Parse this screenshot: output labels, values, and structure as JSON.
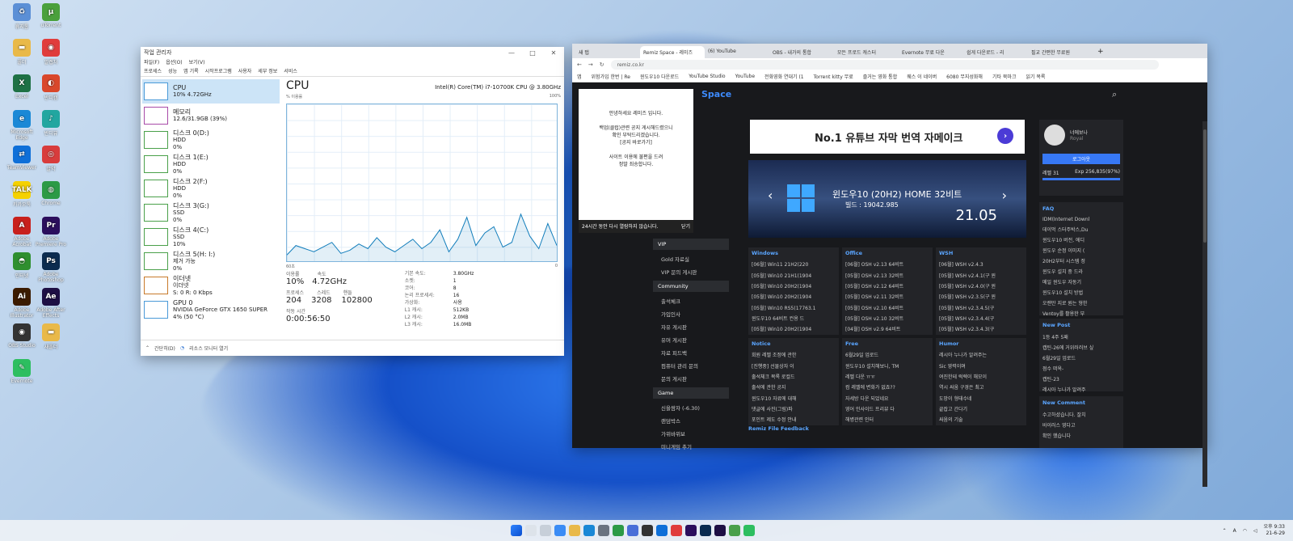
{
  "desktop": {
    "icons": [
      {
        "label": "휴지통",
        "color": "#5b8fd6",
        "glyph": "♻"
      },
      {
        "label": "uTorrent",
        "color": "#4aa03c",
        "glyph": "µ"
      },
      {
        "label": "폴더",
        "color": "#e9b949",
        "glyph": "▬"
      },
      {
        "label": "알캡처",
        "color": "#e03c3c",
        "glyph": "◉"
      },
      {
        "label": "Excel",
        "color": "#1e7145",
        "glyph": "X"
      },
      {
        "label": "반디캠",
        "color": "#d9472b",
        "glyph": "◐"
      },
      {
        "label": "Microsoft Edge",
        "color": "#1a88d6",
        "glyph": "e"
      },
      {
        "label": "반디뷰",
        "color": "#22a6a0",
        "glyph": "♪"
      },
      {
        "label": "TeamViewer",
        "color": "#0e6fd8",
        "glyph": "⇄"
      },
      {
        "label": "알약",
        "color": "#d83c3c",
        "glyph": "◎"
      },
      {
        "label": "카카오톡",
        "color": "#f5d100",
        "glyph": "TALK"
      },
      {
        "label": "Chrome",
        "color": "#2c9a46",
        "glyph": "◍"
      },
      {
        "label": "Adobe Acrobat",
        "color": "#c8201c",
        "glyph": "A"
      },
      {
        "label": "Adobe Premiere Pro",
        "color": "#2b0e5c",
        "glyph": "Pr"
      },
      {
        "label": "인터넷",
        "color": "#2f8f2f",
        "glyph": "◓"
      },
      {
        "label": "Adobe Photoshop",
        "color": "#0b2b4f",
        "glyph": "Ps"
      },
      {
        "label": "Adobe Illustrator",
        "color": "#3b1b00",
        "glyph": "Ai"
      },
      {
        "label": "Adobe After Effects",
        "color": "#1e0f44",
        "glyph": "Ae"
      },
      {
        "label": "OBS Studio",
        "color": "#333333",
        "glyph": "◉"
      },
      {
        "label": "새폴더",
        "color": "#e9b949",
        "glyph": "▬"
      },
      {
        "label": "Evernote",
        "color": "#2dbe60",
        "glyph": "✎"
      }
    ]
  },
  "taskmgr": {
    "title": "작업 관리자",
    "controls": {
      "min": "—",
      "max": "□",
      "close": "✕"
    },
    "menu": [
      "파일(F)",
      "옵션(O)",
      "보기(V)"
    ],
    "tabs": [
      "프로세스",
      "성능",
      "앱 기록",
      "시작프로그램",
      "사용자",
      "세부 정보",
      "서비스"
    ],
    "side": [
      {
        "name": "CPU",
        "sub": "10% 4.72GHz",
        "border": "#4a9ad8"
      },
      {
        "name": "메모리",
        "sub": "12.6/31.9GB (39%)",
        "border": "#a84aa8"
      },
      {
        "name": "디스크 0(D:)",
        "sub": "HDD\n0%",
        "border": "#4aa04a"
      },
      {
        "name": "디스크 1(E:)",
        "sub": "HDD\n0%",
        "border": "#4aa04a"
      },
      {
        "name": "디스크 2(F:)",
        "sub": "HDD\n0%",
        "border": "#4aa04a"
      },
      {
        "name": "디스크 3(G:)",
        "sub": "SSD\n0%",
        "border": "#4aa04a"
      },
      {
        "name": "디스크 4(C:)",
        "sub": "SSD\n10%",
        "border": "#4aa04a"
      },
      {
        "name": "디스크 5(H: I:)",
        "sub": "제거 가능\n0%",
        "border": "#4aa04a"
      },
      {
        "name": "이더넷",
        "sub": "이더넷\nS: 0 R: 0 Kbps",
        "border": "#c87a2a"
      },
      {
        "name": "GPU 0",
        "sub": "NVIDIA GeForce GTX 1650 SUPER\n4% (50 °C)",
        "border": "#4a9ad8"
      }
    ],
    "main": {
      "title": "CPU",
      "model": "Intel(R) Core(TM) i7-10700K CPU @ 3.80GHz",
      "ylabel": "% 이용률",
      "ymax": "100%",
      "xmin": "60초",
      "xmax": "0"
    },
    "stats": {
      "util_label": "이용률",
      "util": "10%",
      "speed_label": "속도",
      "speed": "4.72GHz",
      "proc_label": "프로세스",
      "proc": "204",
      "thread_label": "스레드",
      "thread": "3208",
      "handle_label": "핸들",
      "handle": "102800",
      "uptime_label": "작동 시간",
      "uptime": "0:00:56:50"
    },
    "specs": [
      [
        "기본 속도:",
        "3.80GHz"
      ],
      [
        "소켓:",
        "1"
      ],
      [
        "코어:",
        "8"
      ],
      [
        "논리 프로세서:",
        "16"
      ],
      [
        "가상화:",
        "사용"
      ],
      [
        "L1 캐시:",
        "512KB"
      ],
      [
        "L2 캐시:",
        "2.0MB"
      ],
      [
        "L3 캐시:",
        "16.0MB"
      ]
    ],
    "footer": {
      "simple": "간단히(D)",
      "monitor": "리소스 모니터 열기"
    }
  },
  "chart_data": {
    "type": "line",
    "title": "CPU",
    "ylabel": "% 이용률",
    "ylim": [
      0,
      100
    ],
    "x": [
      0,
      2,
      4,
      6,
      8,
      10,
      12,
      14,
      16,
      18,
      20,
      22,
      24,
      26,
      28,
      30,
      32,
      34,
      36,
      38,
      40,
      42,
      44,
      46,
      48,
      50,
      52,
      54,
      56,
      58,
      60
    ],
    "values": [
      4,
      10,
      8,
      6,
      9,
      12,
      5,
      7,
      11,
      8,
      15,
      9,
      6,
      10,
      14,
      8,
      12,
      20,
      6,
      14,
      28,
      10,
      18,
      22,
      9,
      12,
      30,
      16,
      8,
      24,
      10
    ]
  },
  "browser": {
    "tabs": [
      "새 탭",
      "Remiz Space - 레미즈",
      "(6) YouTube",
      "OBS - 내가의 통합",
      "모든 프로드 캐스터",
      "Evernote 무료 다운",
      "쉽게 다운로드 - 리",
      "필교 간편한 무료원"
    ],
    "url": "remiz.co.kr",
    "bookmarks": [
      "앱",
      "위험가입 한번 | Re",
      "윈도우10 다운로드",
      "YouTube Studio",
      "YouTube",
      "전화영화 연대기 (1",
      "Torrent kitty 무료",
      "즐거는 영화 통합",
      "웨스 이 네이버",
      "6080 무지성화해",
      "기타 북마크",
      "읽기 목록"
    ],
    "site": {
      "logo": "Space",
      "popup": {
        "l1": "안녕하세요 레미즈 입니다.",
        "l2": "백업(클럽)관련 공지 게시해드렸으니",
        "l3": "확인 부탁드리겠습니다.",
        "l4": "[공지 바로가기]",
        "l5": "사이트 이용에 불편을 드려",
        "l6": "정말 죄송합니다.",
        "bottom": "24시간 동안 다시 열람하지 않습니다.",
        "close": "닫기"
      },
      "leftmenu": [
        {
          "h": "VIP",
          "items": [
            "Gold 자료실",
            "VIP 문의 게시판"
          ]
        },
        {
          "h": "Community",
          "items": [
            "출석체크",
            "가입인사",
            "자유 게시판",
            "유머 게시판",
            "자료 피드백",
            "컴퓨터 관리 문의",
            "문의 게시판"
          ]
        },
        {
          "h": "Game",
          "items": [
            "신을쌈자 (-6.30)",
            "랜덤박스",
            "가위바위보",
            "미니게임 추기"
          ]
        }
      ],
      "ad": {
        "text": "No.1 유튜브 자막 번역 자메이크",
        "go": "›"
      },
      "banner": {
        "t1": "윈도우10 (20H2) HOME 32비트",
        "t2": "빌드 : 19042.985",
        "t3": "21.05",
        "prev": "‹",
        "next": "›"
      },
      "cols": [
        {
          "h": "Windows",
          "rows": [
            "[06월] Win11 21H2(220",
            "[05월] Win10 21H1(1904",
            "[05월] Win10 20H2(1904",
            "[05월] Win10 20H2(1904",
            "[05월] Win10 RS5(17763.1",
            "윈도우10 64비트 컨용 드",
            "[05월] Win10 20H2(1904"
          ]
        },
        {
          "h": "Office",
          "rows": [
            "[06월] OSH v2.13 64비트",
            "[05월] OSH v2.13 32비트",
            "[05월] OSH v2.12 64비트",
            "[05월] OSH v2.11 32비트",
            "[05월] OSH v2.10 64비트",
            "[05월] OSH v2.10 32비트",
            "[04월] OSH v2.9 64비트"
          ]
        },
        {
          "h": "WSH",
          "rows": [
            "[06월] WSH v2.4.3",
            "[05월] WSH v2.4.1(구 윈",
            "[05월] WSH v2.4.0(구 윈",
            "[05월] WSH v2.3.5(구 윈",
            "[05월] WSH v2.3.4.5(구",
            "[05월] WSH v2.3.4.4(구",
            "[05월] WSH v2.3.4.3(구"
          ]
        },
        {
          "h": "Notice",
          "rows": [
            "회원 레벨 조정에 관한",
            "[진행중] 선물상자 이",
            "출석체크 목록 로컬드",
            "출석에 관한 공지",
            "윈도우10 자료에 대해",
            "댓글에 사진(그림)파",
            "포인트 제도 수정 안내"
          ]
        },
        {
          "h": "Free",
          "rows": [
            "6월29일 업로드",
            "윈도우10 설치해보니, TM",
            "레벨 다운 ㅠㅠ",
            "컴 레벨에 변화가 없죠??",
            "자세방 다운 되었네요",
            "영어 인사이드 프리뷰 다",
            "해병관련 인터"
          ]
        },
        {
          "h": "Humor",
          "rows": [
            "레시아 누나가 알려주는",
            "Sic 영력이며",
            "여진한테 럭렉이 해모이",
            "역시 싸움 구경은 최고",
            "도망이 형태수네",
            "끝잡고 간다기",
            "싸움의 기술"
          ]
        }
      ],
      "user": {
        "name": "너에보나",
        "role": "Royal",
        "login": "로그아웃",
        "level": "레벨 31",
        "exp": "Exp 256,835(97%)"
      },
      "faq": {
        "h": "FAQ",
        "rows": [
          "IDM(Internet Downl",
          "데이먹 스터주박스,Du",
          "윈도우10 버전, 에디",
          "윈도우 순정 이미지 (",
          "20H2부터 시스템 정",
          "윈도우 설치 중 드라",
          "메일 윈도우 자동기",
          "윈도우10 설치 방법",
          "오랜만 지로 원는 형한",
          "Ventoy를 활용한 부"
        ]
      },
      "newpost": {
        "h": "New Post",
        "rows": [
          "1등 4주 5패",
          "캡틴-26에 거위러러브 싶",
          "6월29일 업로드",
          "점수 떠옥-",
          "캡틴-23",
          "레시아 누나가 알려주"
        ]
      },
      "newcomment": {
        "h": "New Comment",
        "rows": [
          "수고하셨습니다. 잘치",
          "바이러스 영다고",
          "확인 했습니다"
        ]
      },
      "feedback": "Remiz File Feedback"
    }
  },
  "taskbar": {
    "time": "오후 9:33",
    "date": "21-6-29",
    "lang": "A"
  }
}
